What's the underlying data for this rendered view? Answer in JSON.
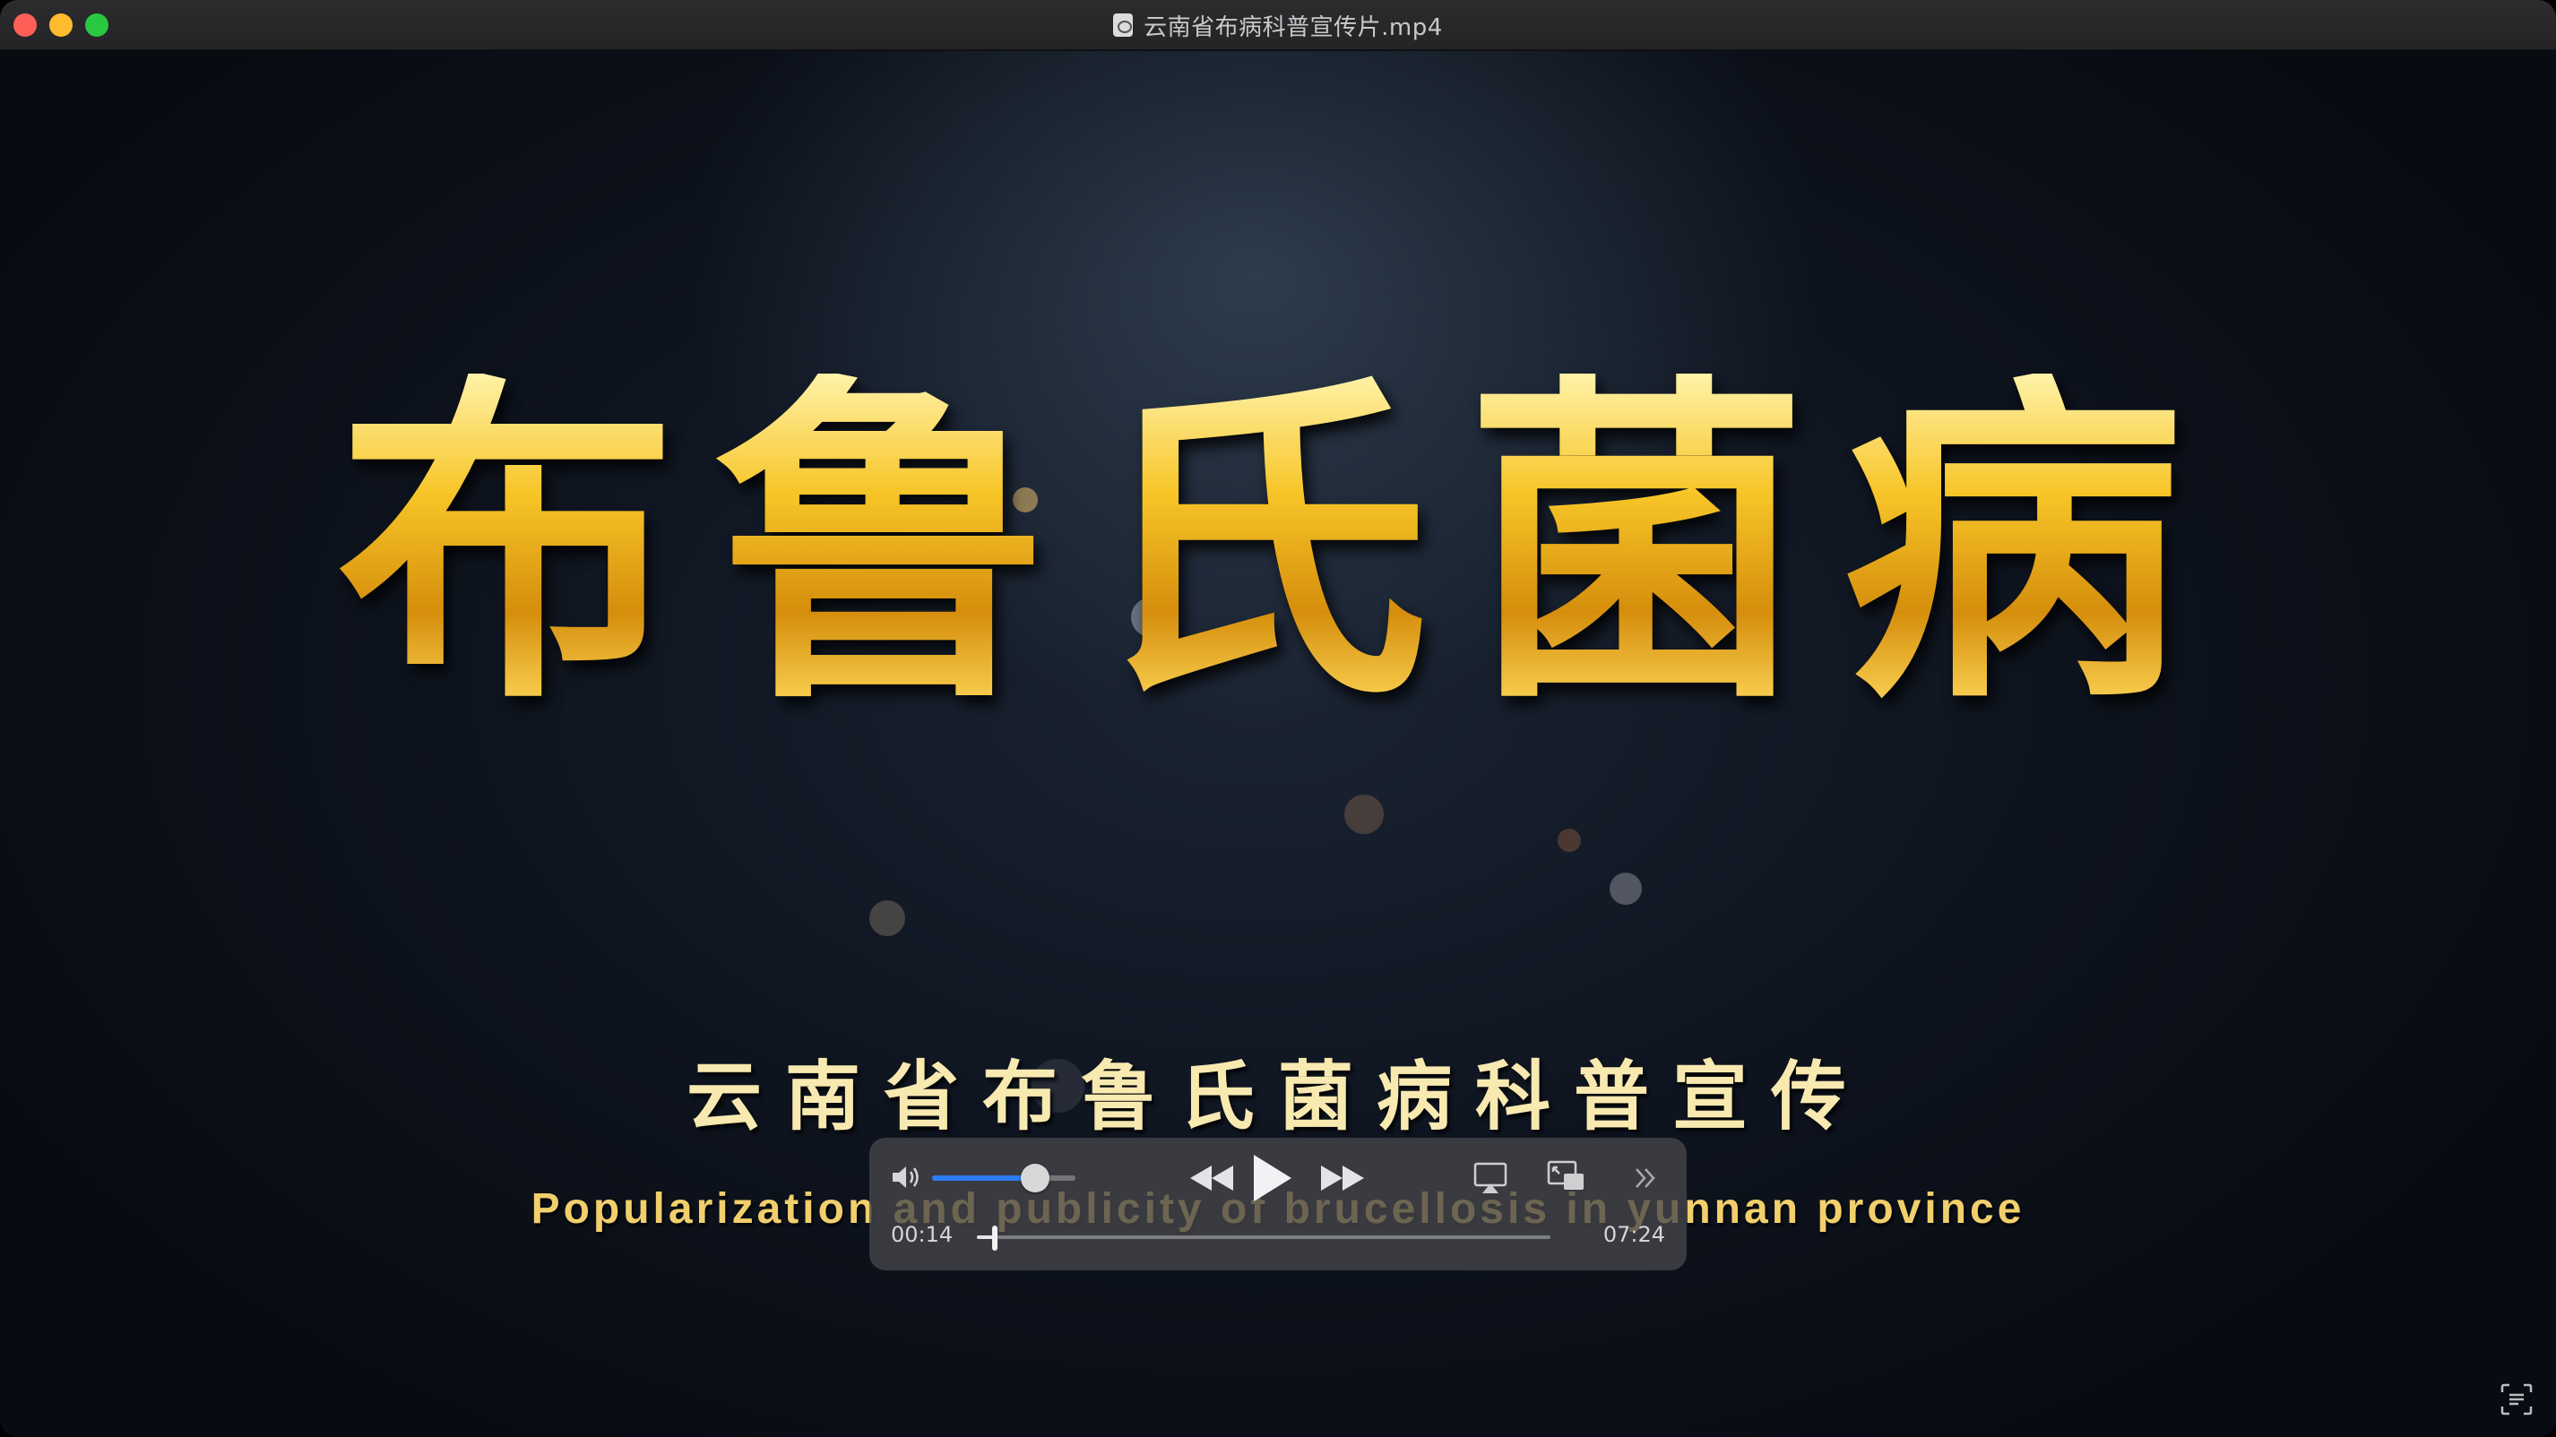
{
  "window": {
    "title": "云南省布病科普宣传片.mp4"
  },
  "video": {
    "title": "布鲁氏菌病",
    "subtitle_cn": "云南省布鲁氏菌病科普宣传",
    "subtitle_en": "Popularization and publicity of  brucellosis  in yunnan province"
  },
  "player": {
    "current_time": "00:14",
    "duration": "07:24",
    "volume": 0.72,
    "progress": 0.032
  },
  "icons": {
    "close": "close-icon",
    "minimize": "minimize-icon",
    "maximize": "maximize-icon",
    "volume": "speaker-icon",
    "rewind": "rewind-icon",
    "play": "play-icon",
    "fast_forward": "fast-forward-icon",
    "airplay": "airplay-icon",
    "pip": "picture-in-picture-icon",
    "more": "chevron-double-right-icon",
    "live_text": "live-text-icon"
  },
  "colors": {
    "accent": "#2f7cf6",
    "gold": "#f3b81f"
  }
}
